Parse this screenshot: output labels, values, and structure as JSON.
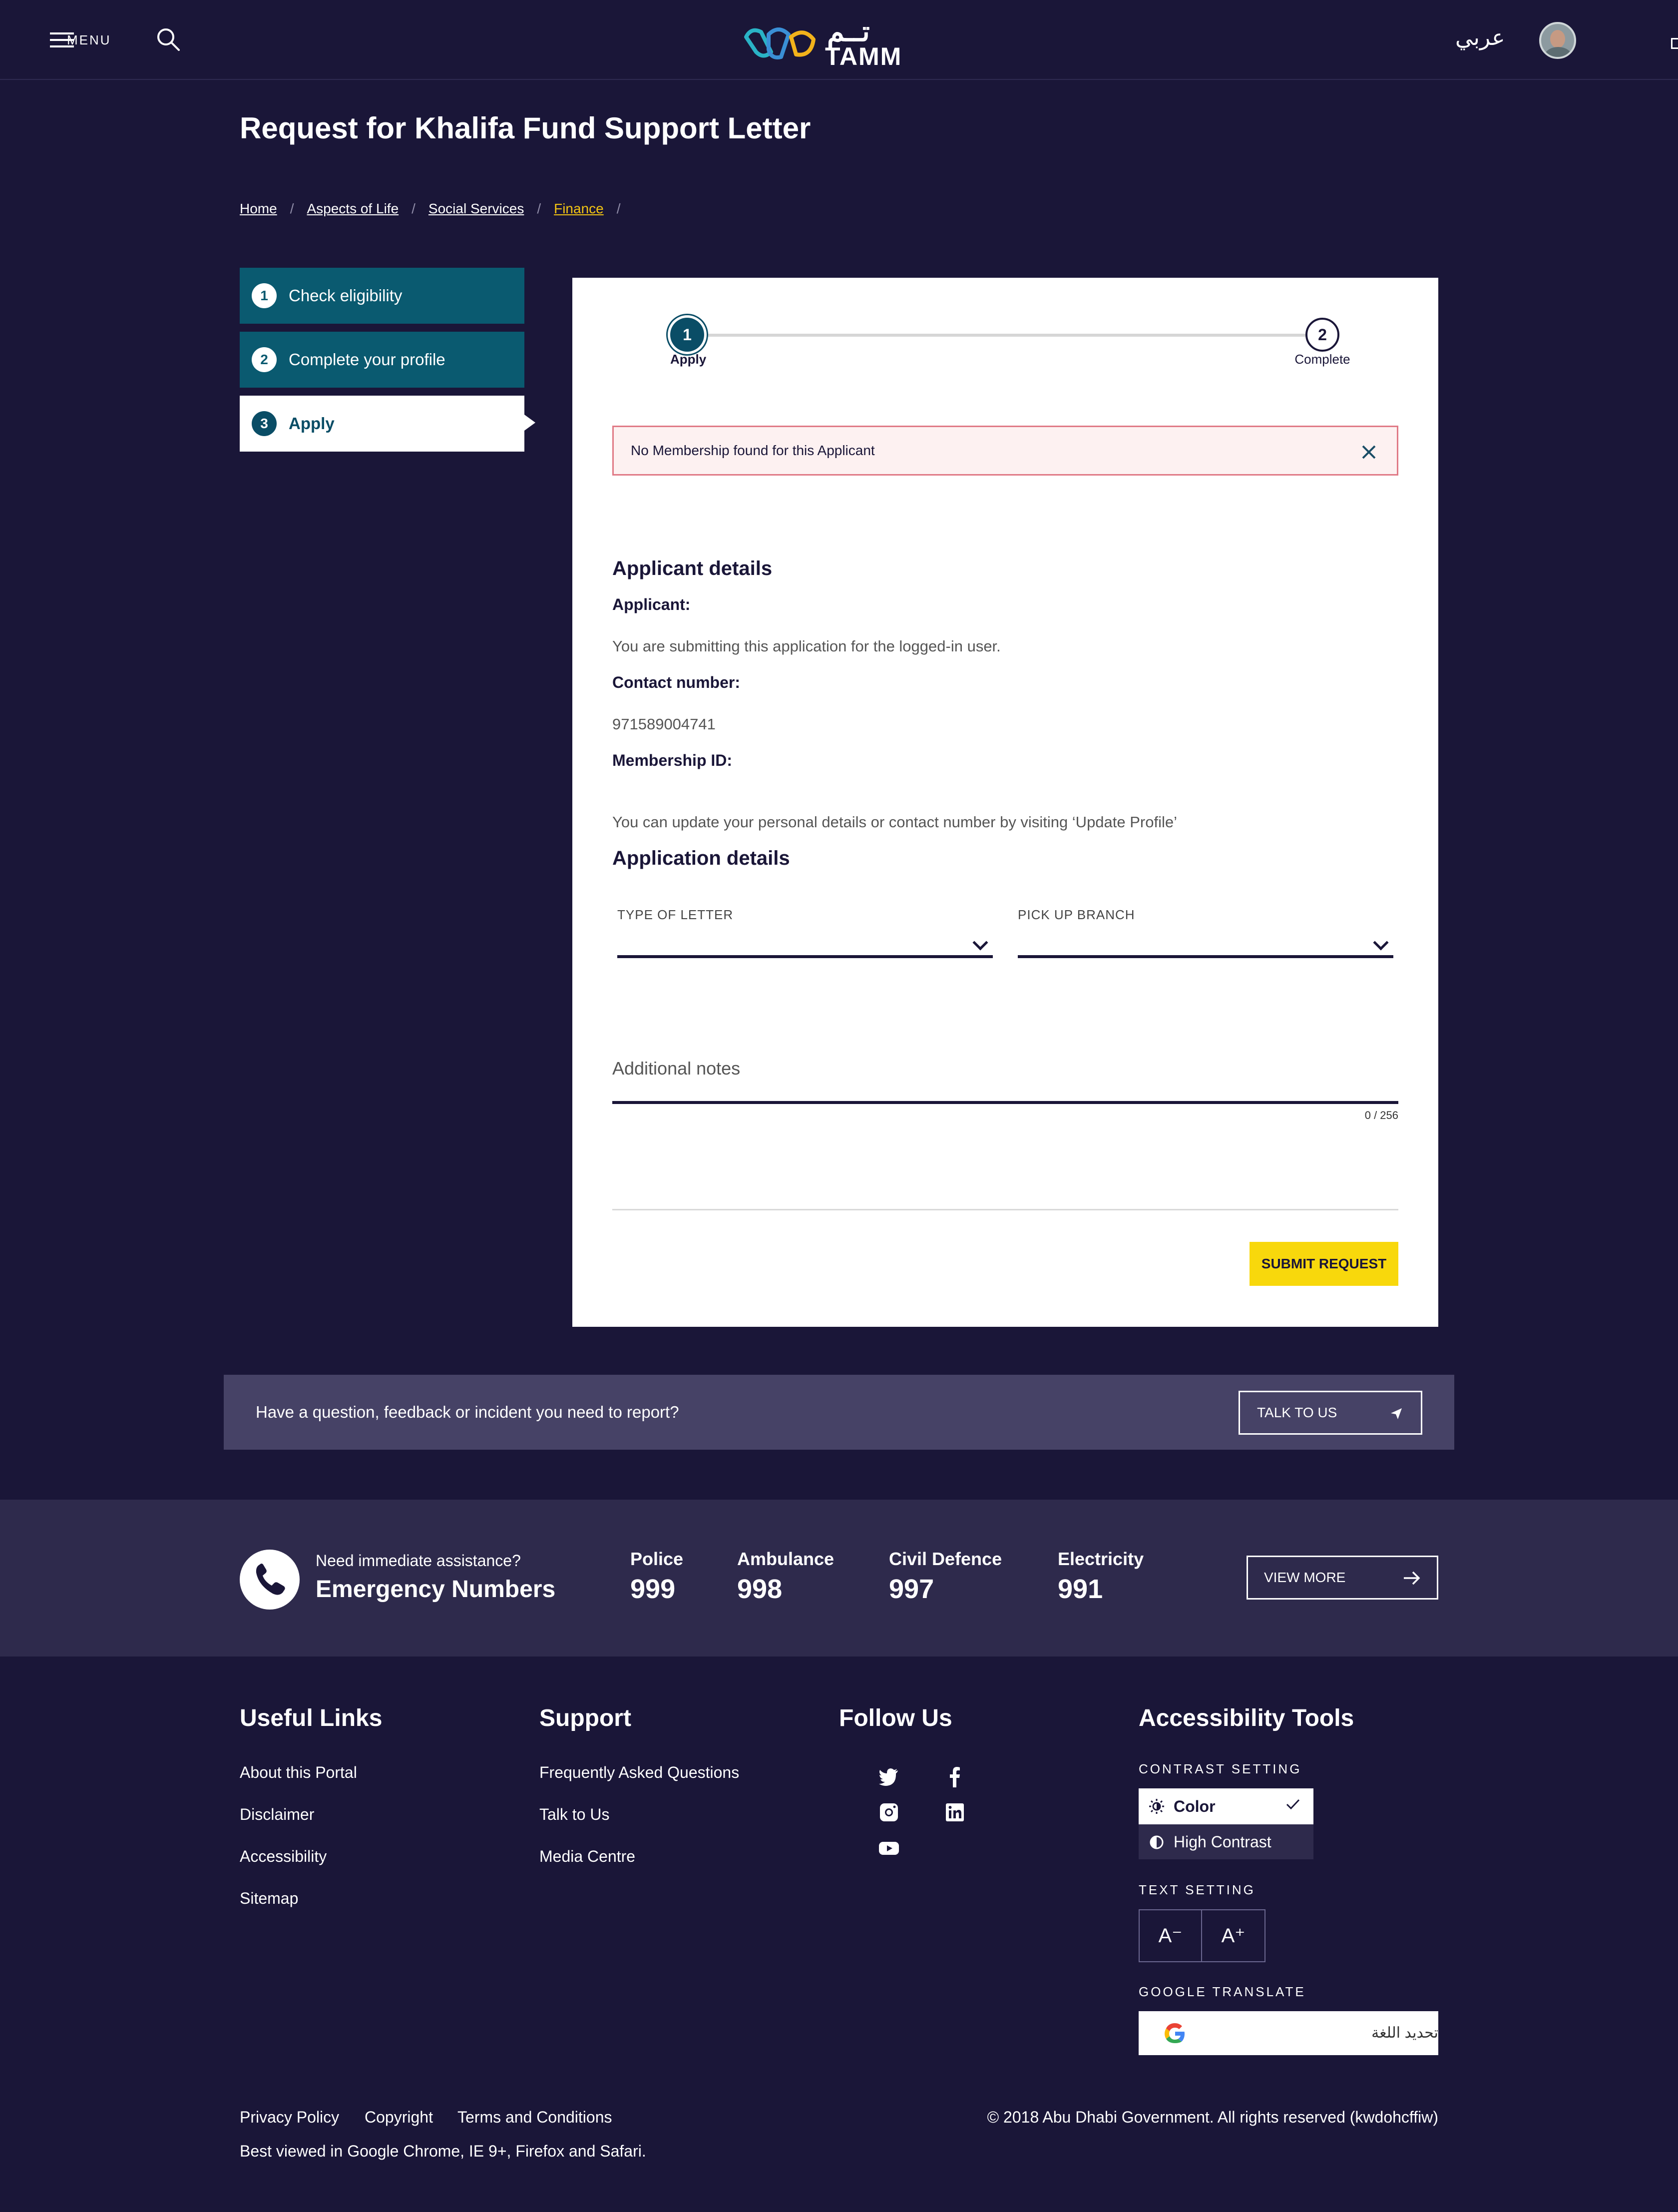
{
  "header": {
    "menu_label": "MENU",
    "logo_en": "TAMM",
    "logo_ar": "تــم",
    "language": "عربي"
  },
  "page": {
    "title": "Request for Khalifa Fund Support Letter",
    "breadcrumb": [
      "Home",
      "Aspects of Life",
      "Social Services",
      "Finance"
    ]
  },
  "steps": [
    {
      "num": "1",
      "label": "Check eligibility"
    },
    {
      "num": "2",
      "label": "Complete your profile"
    },
    {
      "num": "3",
      "label": "Apply"
    }
  ],
  "progress": {
    "step1_num": "1",
    "step1_label": "Apply",
    "step2_num": "2",
    "step2_label": "Complete"
  },
  "alert": {
    "message": "No Membership found for this Applicant"
  },
  "applicant": {
    "heading": "Applicant details",
    "applicant_label": "Applicant:",
    "applicant_text": "You are submitting this application for the logged-in user.",
    "contact_label": "Contact number:",
    "contact_value": "971589004741",
    "membership_label": "Membership ID:",
    "update_note": "You can update your personal details or contact number by visiting ‘Update Profile’"
  },
  "application": {
    "heading": "Application details",
    "type_of_letter_label": "TYPE OF LETTER",
    "pickup_branch_label": "PICK UP BRANCH",
    "notes_placeholder": "Additional notes",
    "counter": "0 / 256",
    "submit_label": "SUBMIT REQUEST"
  },
  "feedback": {
    "question": "Have a question, feedback or incident you need to report?",
    "button": "TALK TO US"
  },
  "emergency": {
    "need": "Need immediate assistance?",
    "title": "Emergency Numbers",
    "numbers": [
      {
        "name": "Police",
        "value": "999"
      },
      {
        "name": "Ambulance",
        "value": "998"
      },
      {
        "name": "Civil Defence",
        "value": "997"
      },
      {
        "name": "Electricity",
        "value": "991"
      }
    ],
    "view_more": "VIEW MORE"
  },
  "footer": {
    "useful_links_title": "Useful Links",
    "useful_links": [
      "About this Portal",
      "Disclaimer",
      "Accessibility",
      "Sitemap"
    ],
    "support_title": "Support",
    "support_links": [
      "Frequently Asked Questions",
      "Talk to Us",
      "Media Centre"
    ],
    "follow_title": "Follow Us",
    "social_icons": [
      "twitter-icon",
      "facebook-icon",
      "instagram-icon",
      "linkedin-icon",
      "youtube-icon"
    ],
    "accessibility_title": "Accessibility Tools",
    "contrast_label": "CONTRAST SETTING",
    "contrast_color": "Color",
    "contrast_high": "High Contrast",
    "text_setting_label": "TEXT SETTING",
    "text_decrease": "A⁻",
    "text_increase": "A⁺",
    "translate_label": "GOOGLE TRANSLATE",
    "translate_text": "تحديد اللغة",
    "bottom_links": [
      "Privacy Policy",
      "Copyright",
      "Terms and Conditions"
    ],
    "best_viewed": "Best viewed in Google Chrome, IE 9+, Firefox and Safari.",
    "copyright": "© 2018 Abu Dhabi Government. All rights reserved (kwdohcffiw)"
  },
  "colors": {
    "background": "#1a1638",
    "step_teal": "#0a5a70",
    "accent_yellow": "#f8d80c",
    "breadcrumb_active": "#f2c413",
    "alert_border": "#e07a86"
  }
}
